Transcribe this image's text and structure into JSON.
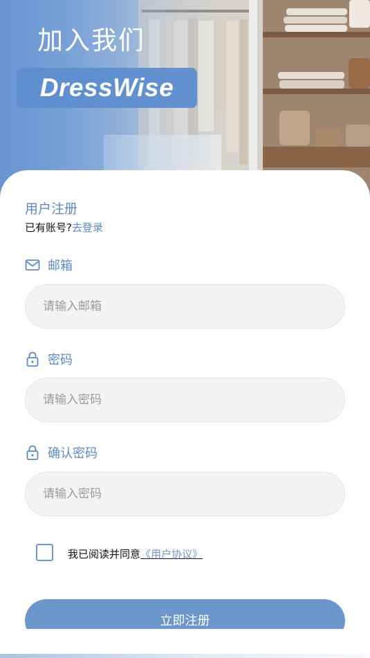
{
  "hero": {
    "title": "加入我们",
    "brand": "DressWise"
  },
  "form": {
    "heading": "用户注册",
    "login_prompt": "已有账号?",
    "login_link": "去登录",
    "email": {
      "label": "邮箱",
      "placeholder": "请输入邮箱",
      "icon": "mail-icon"
    },
    "password": {
      "label": "密码",
      "placeholder": "请输入密码",
      "icon": "lock-icon"
    },
    "confirm": {
      "label": "确认密码",
      "placeholder": "请输入密码",
      "icon": "lock-icon"
    },
    "agreement": {
      "text": "我已阅读并同意",
      "link": "《用户协议》",
      "checked": false
    },
    "submit_label": "立即注册"
  },
  "colors": {
    "accent": "#6b97cd",
    "label": "#5d8ac7",
    "input_bg": "#f4f4f4"
  }
}
